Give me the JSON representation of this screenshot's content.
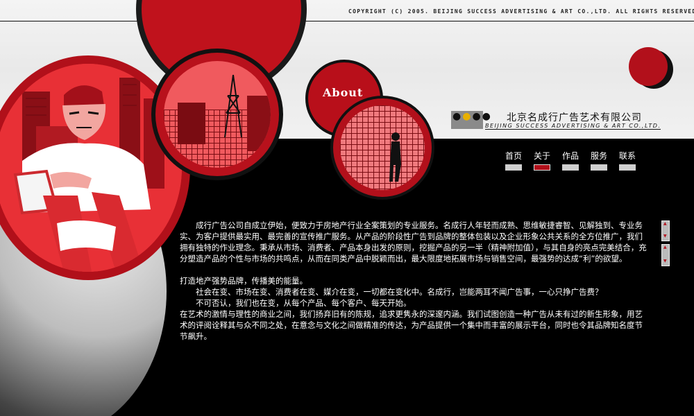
{
  "header": {
    "copyright": "COPYRIGHT (C) 2005. BEIJING SUCCESS ADVERTISING & ART CO.,LTD. ALL RIGHTS RESERVED."
  },
  "section": {
    "title": "About"
  },
  "company": {
    "name_cn": "北京名成行广告艺术有限公司",
    "name_en": "BEIJING SUCCESS ADVERTISING & ART CO.,LTD."
  },
  "nav": {
    "items": [
      {
        "label": "首页",
        "active": false
      },
      {
        "label": "关于",
        "active": true
      },
      {
        "label": "作品",
        "active": false
      },
      {
        "label": "服务",
        "active": false
      },
      {
        "label": "联系",
        "active": false
      }
    ]
  },
  "content": {
    "p1": "成行广告公司自成立伊始，便致力于房地产行业全案策划的专业服务。名成行人年轻而成熟、思维敏捷睿智、见解独到、专业务实、为客户提供最实用、最完善的宣传推广服务。从产品的阶段性广告到品牌的整体包装以及企业形象公共关系的全方位推广，我们拥有独特的作业理念。秉承从市场、消费者、产品本身出发的原则，挖掘产品的另一半（精神附加值），与其自身的亮点完美结合，充分塑造产品的个性与市场的共鸣点，从而在同类产品中脱颖而出，最大限度地拓展市场与销售空间，最强势的达成“利”的欲望。",
    "p2": "打造地产强势品牌，传播美的能量。",
    "p3": "社会在变、市场在变、消费者在变、媒介在变，一切都在变化中。名成行，岂能两耳不闻广告事，一心只挣广告费？",
    "p4": "不可否认，我们也在变，从每个产品、每个客户、每天开始。",
    "p5": "在艺术的激情与理性的商业之间，我们扬弃旧有的陈规，追求更隽永的深邃内涵。我们试图创造一种广告从未有过的新生形象，用艺术的评阅诠释其与众不同之处，在意念与文化之间做精准的传达，为产品提供一个集中而丰富的展示平台，同时也令其品牌知名度节节飙升。"
  },
  "icons": {
    "scroll_up": "scroll-up-arrow-icon",
    "scroll_down": "scroll-down-arrow-icon",
    "logo": "company-logo-icon"
  },
  "colors": {
    "brand_red": "#b2101b",
    "light_red": "#e83036",
    "background": "#000000",
    "header_bg": "#f0f0f0"
  }
}
